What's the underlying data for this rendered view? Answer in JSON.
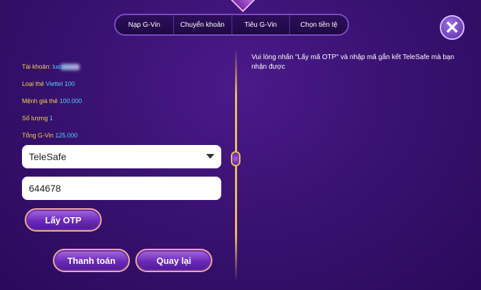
{
  "tabs": [
    {
      "label": "Nạp G-Vin"
    },
    {
      "label": "Chuyển khoản"
    },
    {
      "label": "Tiêu G-Vin"
    },
    {
      "label": "Chọn tiền tệ"
    }
  ],
  "close_icon": "close-icon",
  "info": {
    "account_label": "Tài khoản:",
    "account_value": "luc",
    "card_type_label": "Loại thẻ",
    "card_type_value": "Viettel 100",
    "face_value_label": "Mệnh giá thẻ",
    "face_value_value": "100.000",
    "quantity_label": "Số lượng",
    "quantity_value": "1",
    "total_label": "Tổng G-Vin",
    "total_value": "125.000"
  },
  "method_select": {
    "value": "TeleSafe"
  },
  "otp_input": {
    "value": "644678"
  },
  "buttons": {
    "get_otp": "Lấy OTP",
    "pay": "Thanh toán",
    "back": "Quay lại"
  },
  "notice": "Vui lòng nhấn \"Lấy mã OTP\" và nhập mã gắn kết TeleSafe mà bạn nhận được",
  "colors": {
    "label": "#f3d34a",
    "value": "#4dd2ff",
    "accent": "#6a2ab8"
  }
}
